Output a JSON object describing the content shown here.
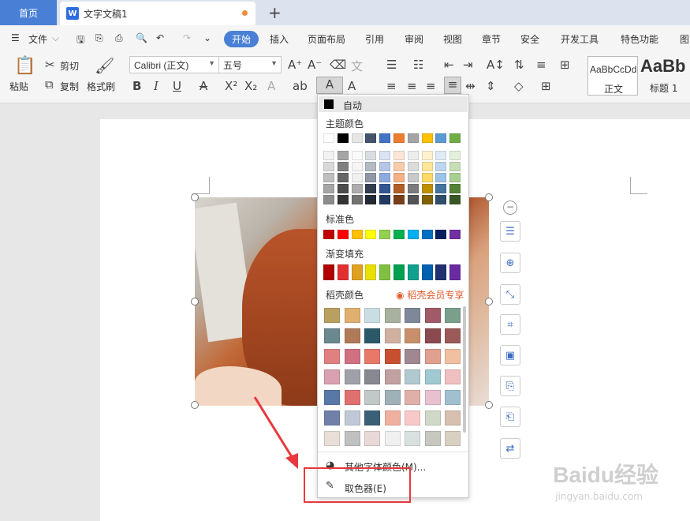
{
  "tabs": {
    "home": "首页",
    "doc_title": "文字文稿1",
    "doc_icon": "W"
  },
  "menu": {
    "file": "文件",
    "active": "开始",
    "items": [
      "插入",
      "页面布局",
      "引用",
      "审阅",
      "视图",
      "章节",
      "安全",
      "开发工具",
      "特色功能",
      "图"
    ]
  },
  "ribbon": {
    "paste": "粘贴",
    "cut": "剪切",
    "copy": "复制",
    "format_painter": "格式刷",
    "font_name": "Calibri (正文)",
    "font_size": "五号",
    "style_normal_preview": "AaBbCcDd",
    "style_normal": "正文",
    "style_h1_preview": "AaBb",
    "style_h1": "标题 1"
  },
  "palette": {
    "auto": "自动",
    "theme": "主题颜色",
    "standard": "标准色",
    "gradient": "渐变填充",
    "dochu": "稻壳颜色",
    "member": "稻壳会员专享",
    "more": "其他字体颜色(M)...",
    "picker": "取色器(E)",
    "theme_row": [
      "#ffffff",
      "#000000",
      "#e7e6e6",
      "#44546a",
      "#4472c4",
      "#ed7d31",
      "#a5a5a5",
      "#ffc000",
      "#5b9bd5",
      "#70ad47"
    ],
    "standard_row": [
      "#c00000",
      "#ff0000",
      "#ffc000",
      "#ffff00",
      "#92d050",
      "#00b050",
      "#00b0f0",
      "#0070c0",
      "#002060",
      "#7030a0"
    ],
    "gradient_row": [
      "#b00000",
      "#e23030",
      "#e0a020",
      "#e8e000",
      "#80c040",
      "#00a050",
      "#10a090",
      "#0060b0",
      "#203070",
      "#6a2aa0"
    ]
  },
  "watermark": {
    "brand": "Baidu经验",
    "url": "jingyan.baidu.com"
  }
}
